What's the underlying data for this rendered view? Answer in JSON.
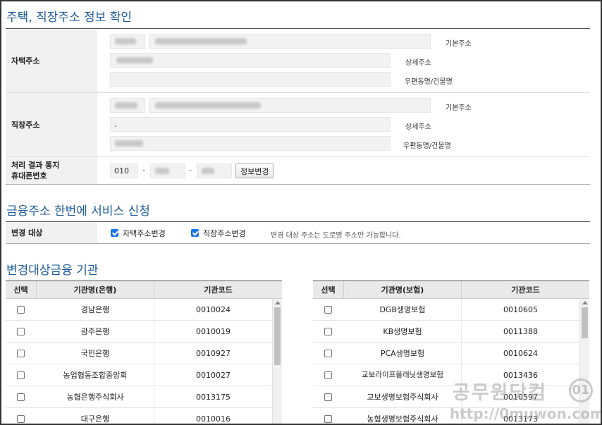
{
  "section1": {
    "title": "주택, 직장주소 정보 확인",
    "home": {
      "label": "자택주소",
      "basic_label": "기본주소",
      "detail_label": "상세주소",
      "road_label": "우편동명/건물명"
    },
    "work": {
      "label": "직장주소",
      "basic_label": "기본주소",
      "detail_label": "상세주소",
      "road_label": "우편동명/건물명",
      "detail_value": "."
    },
    "phone": {
      "label_line1": "처리 결과 통지",
      "label_line2": "휴대폰번호",
      "prefix": "010",
      "dash1": "-",
      "dash2": "-",
      "button": "정보변경"
    }
  },
  "section2": {
    "title": "금융주소 한번에 서비스 신청",
    "change_target_label": "변경 대상",
    "home_change": {
      "label": "자택주소변경",
      "checked": true
    },
    "work_change": {
      "label": "직장주소변경",
      "checked": true
    },
    "note": "변경 대상 주소는 도로명 주소만 가능합니다."
  },
  "section3": {
    "title": "변경대상금융 기관",
    "banks": {
      "headers": [
        "선택",
        "기관명(은행)",
        "기관코드"
      ],
      "rows": [
        {
          "name": "경남은행",
          "code": "0010024"
        },
        {
          "name": "광주은행",
          "code": "0010019"
        },
        {
          "name": "국민은행",
          "code": "0010927"
        },
        {
          "name": "농업협동조합중앙회",
          "code": "0010027"
        },
        {
          "name": "농협은행주식회사",
          "code": "0013175"
        },
        {
          "name": "대구은행",
          "code": "0010016"
        }
      ]
    },
    "insurers": {
      "headers": [
        "선택",
        "기관명(보험)",
        "기관코드"
      ],
      "rows": [
        {
          "name": "DGB생명보험",
          "code": "0010605"
        },
        {
          "name": "KB생명보험",
          "code": "0011388"
        },
        {
          "name": "PCA생명보험",
          "code": "0010624"
        },
        {
          "name": "교보라이프플래닛생명보험",
          "code": "0013436"
        },
        {
          "name": "교보생명보험주식회사",
          "code": "0010597"
        },
        {
          "name": "농협생명보험주식회사",
          "code": "0013173"
        }
      ]
    }
  },
  "watermark": {
    "line1": "공무원닷컴",
    "line2": "http://0muwon.com",
    "logo": "01"
  }
}
